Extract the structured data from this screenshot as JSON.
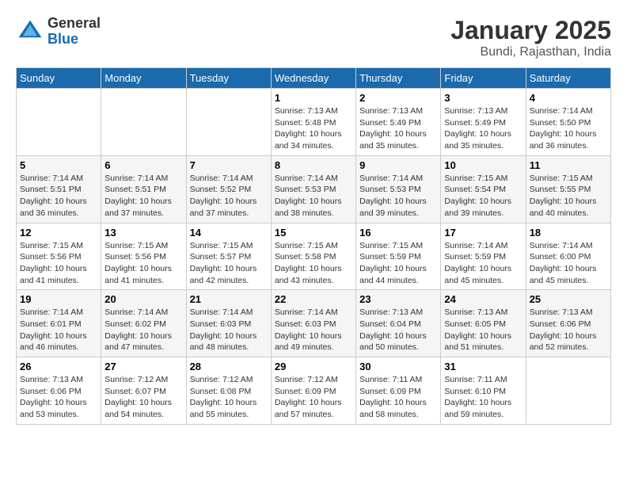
{
  "logo": {
    "general": "General",
    "blue": "Blue"
  },
  "header": {
    "title": "January 2025",
    "subtitle": "Bundi, Rajasthan, India"
  },
  "weekdays": [
    "Sunday",
    "Monday",
    "Tuesday",
    "Wednesday",
    "Thursday",
    "Friday",
    "Saturday"
  ],
  "weeks": [
    [
      {
        "day": "",
        "content": ""
      },
      {
        "day": "",
        "content": ""
      },
      {
        "day": "",
        "content": ""
      },
      {
        "day": "1",
        "content": "Sunrise: 7:13 AM\nSunset: 5:48 PM\nDaylight: 10 hours\nand 34 minutes."
      },
      {
        "day": "2",
        "content": "Sunrise: 7:13 AM\nSunset: 5:49 PM\nDaylight: 10 hours\nand 35 minutes."
      },
      {
        "day": "3",
        "content": "Sunrise: 7:13 AM\nSunset: 5:49 PM\nDaylight: 10 hours\nand 35 minutes."
      },
      {
        "day": "4",
        "content": "Sunrise: 7:14 AM\nSunset: 5:50 PM\nDaylight: 10 hours\nand 36 minutes."
      }
    ],
    [
      {
        "day": "5",
        "content": "Sunrise: 7:14 AM\nSunset: 5:51 PM\nDaylight: 10 hours\nand 36 minutes."
      },
      {
        "day": "6",
        "content": "Sunrise: 7:14 AM\nSunset: 5:51 PM\nDaylight: 10 hours\nand 37 minutes."
      },
      {
        "day": "7",
        "content": "Sunrise: 7:14 AM\nSunset: 5:52 PM\nDaylight: 10 hours\nand 37 minutes."
      },
      {
        "day": "8",
        "content": "Sunrise: 7:14 AM\nSunset: 5:53 PM\nDaylight: 10 hours\nand 38 minutes."
      },
      {
        "day": "9",
        "content": "Sunrise: 7:14 AM\nSunset: 5:53 PM\nDaylight: 10 hours\nand 39 minutes."
      },
      {
        "day": "10",
        "content": "Sunrise: 7:15 AM\nSunset: 5:54 PM\nDaylight: 10 hours\nand 39 minutes."
      },
      {
        "day": "11",
        "content": "Sunrise: 7:15 AM\nSunset: 5:55 PM\nDaylight: 10 hours\nand 40 minutes."
      }
    ],
    [
      {
        "day": "12",
        "content": "Sunrise: 7:15 AM\nSunset: 5:56 PM\nDaylight: 10 hours\nand 41 minutes."
      },
      {
        "day": "13",
        "content": "Sunrise: 7:15 AM\nSunset: 5:56 PM\nDaylight: 10 hours\nand 41 minutes."
      },
      {
        "day": "14",
        "content": "Sunrise: 7:15 AM\nSunset: 5:57 PM\nDaylight: 10 hours\nand 42 minutes."
      },
      {
        "day": "15",
        "content": "Sunrise: 7:15 AM\nSunset: 5:58 PM\nDaylight: 10 hours\nand 43 minutes."
      },
      {
        "day": "16",
        "content": "Sunrise: 7:15 AM\nSunset: 5:59 PM\nDaylight: 10 hours\nand 44 minutes."
      },
      {
        "day": "17",
        "content": "Sunrise: 7:14 AM\nSunset: 5:59 PM\nDaylight: 10 hours\nand 45 minutes."
      },
      {
        "day": "18",
        "content": "Sunrise: 7:14 AM\nSunset: 6:00 PM\nDaylight: 10 hours\nand 45 minutes."
      }
    ],
    [
      {
        "day": "19",
        "content": "Sunrise: 7:14 AM\nSunset: 6:01 PM\nDaylight: 10 hours\nand 46 minutes."
      },
      {
        "day": "20",
        "content": "Sunrise: 7:14 AM\nSunset: 6:02 PM\nDaylight: 10 hours\nand 47 minutes."
      },
      {
        "day": "21",
        "content": "Sunrise: 7:14 AM\nSunset: 6:03 PM\nDaylight: 10 hours\nand 48 minutes."
      },
      {
        "day": "22",
        "content": "Sunrise: 7:14 AM\nSunset: 6:03 PM\nDaylight: 10 hours\nand 49 minutes."
      },
      {
        "day": "23",
        "content": "Sunrise: 7:13 AM\nSunset: 6:04 PM\nDaylight: 10 hours\nand 50 minutes."
      },
      {
        "day": "24",
        "content": "Sunrise: 7:13 AM\nSunset: 6:05 PM\nDaylight: 10 hours\nand 51 minutes."
      },
      {
        "day": "25",
        "content": "Sunrise: 7:13 AM\nSunset: 6:06 PM\nDaylight: 10 hours\nand 52 minutes."
      }
    ],
    [
      {
        "day": "26",
        "content": "Sunrise: 7:13 AM\nSunset: 6:06 PM\nDaylight: 10 hours\nand 53 minutes."
      },
      {
        "day": "27",
        "content": "Sunrise: 7:12 AM\nSunset: 6:07 PM\nDaylight: 10 hours\nand 54 minutes."
      },
      {
        "day": "28",
        "content": "Sunrise: 7:12 AM\nSunset: 6:08 PM\nDaylight: 10 hours\nand 55 minutes."
      },
      {
        "day": "29",
        "content": "Sunrise: 7:12 AM\nSunset: 6:09 PM\nDaylight: 10 hours\nand 57 minutes."
      },
      {
        "day": "30",
        "content": "Sunrise: 7:11 AM\nSunset: 6:09 PM\nDaylight: 10 hours\nand 58 minutes."
      },
      {
        "day": "31",
        "content": "Sunrise: 7:11 AM\nSunset: 6:10 PM\nDaylight: 10 hours\nand 59 minutes."
      },
      {
        "day": "",
        "content": ""
      }
    ]
  ]
}
